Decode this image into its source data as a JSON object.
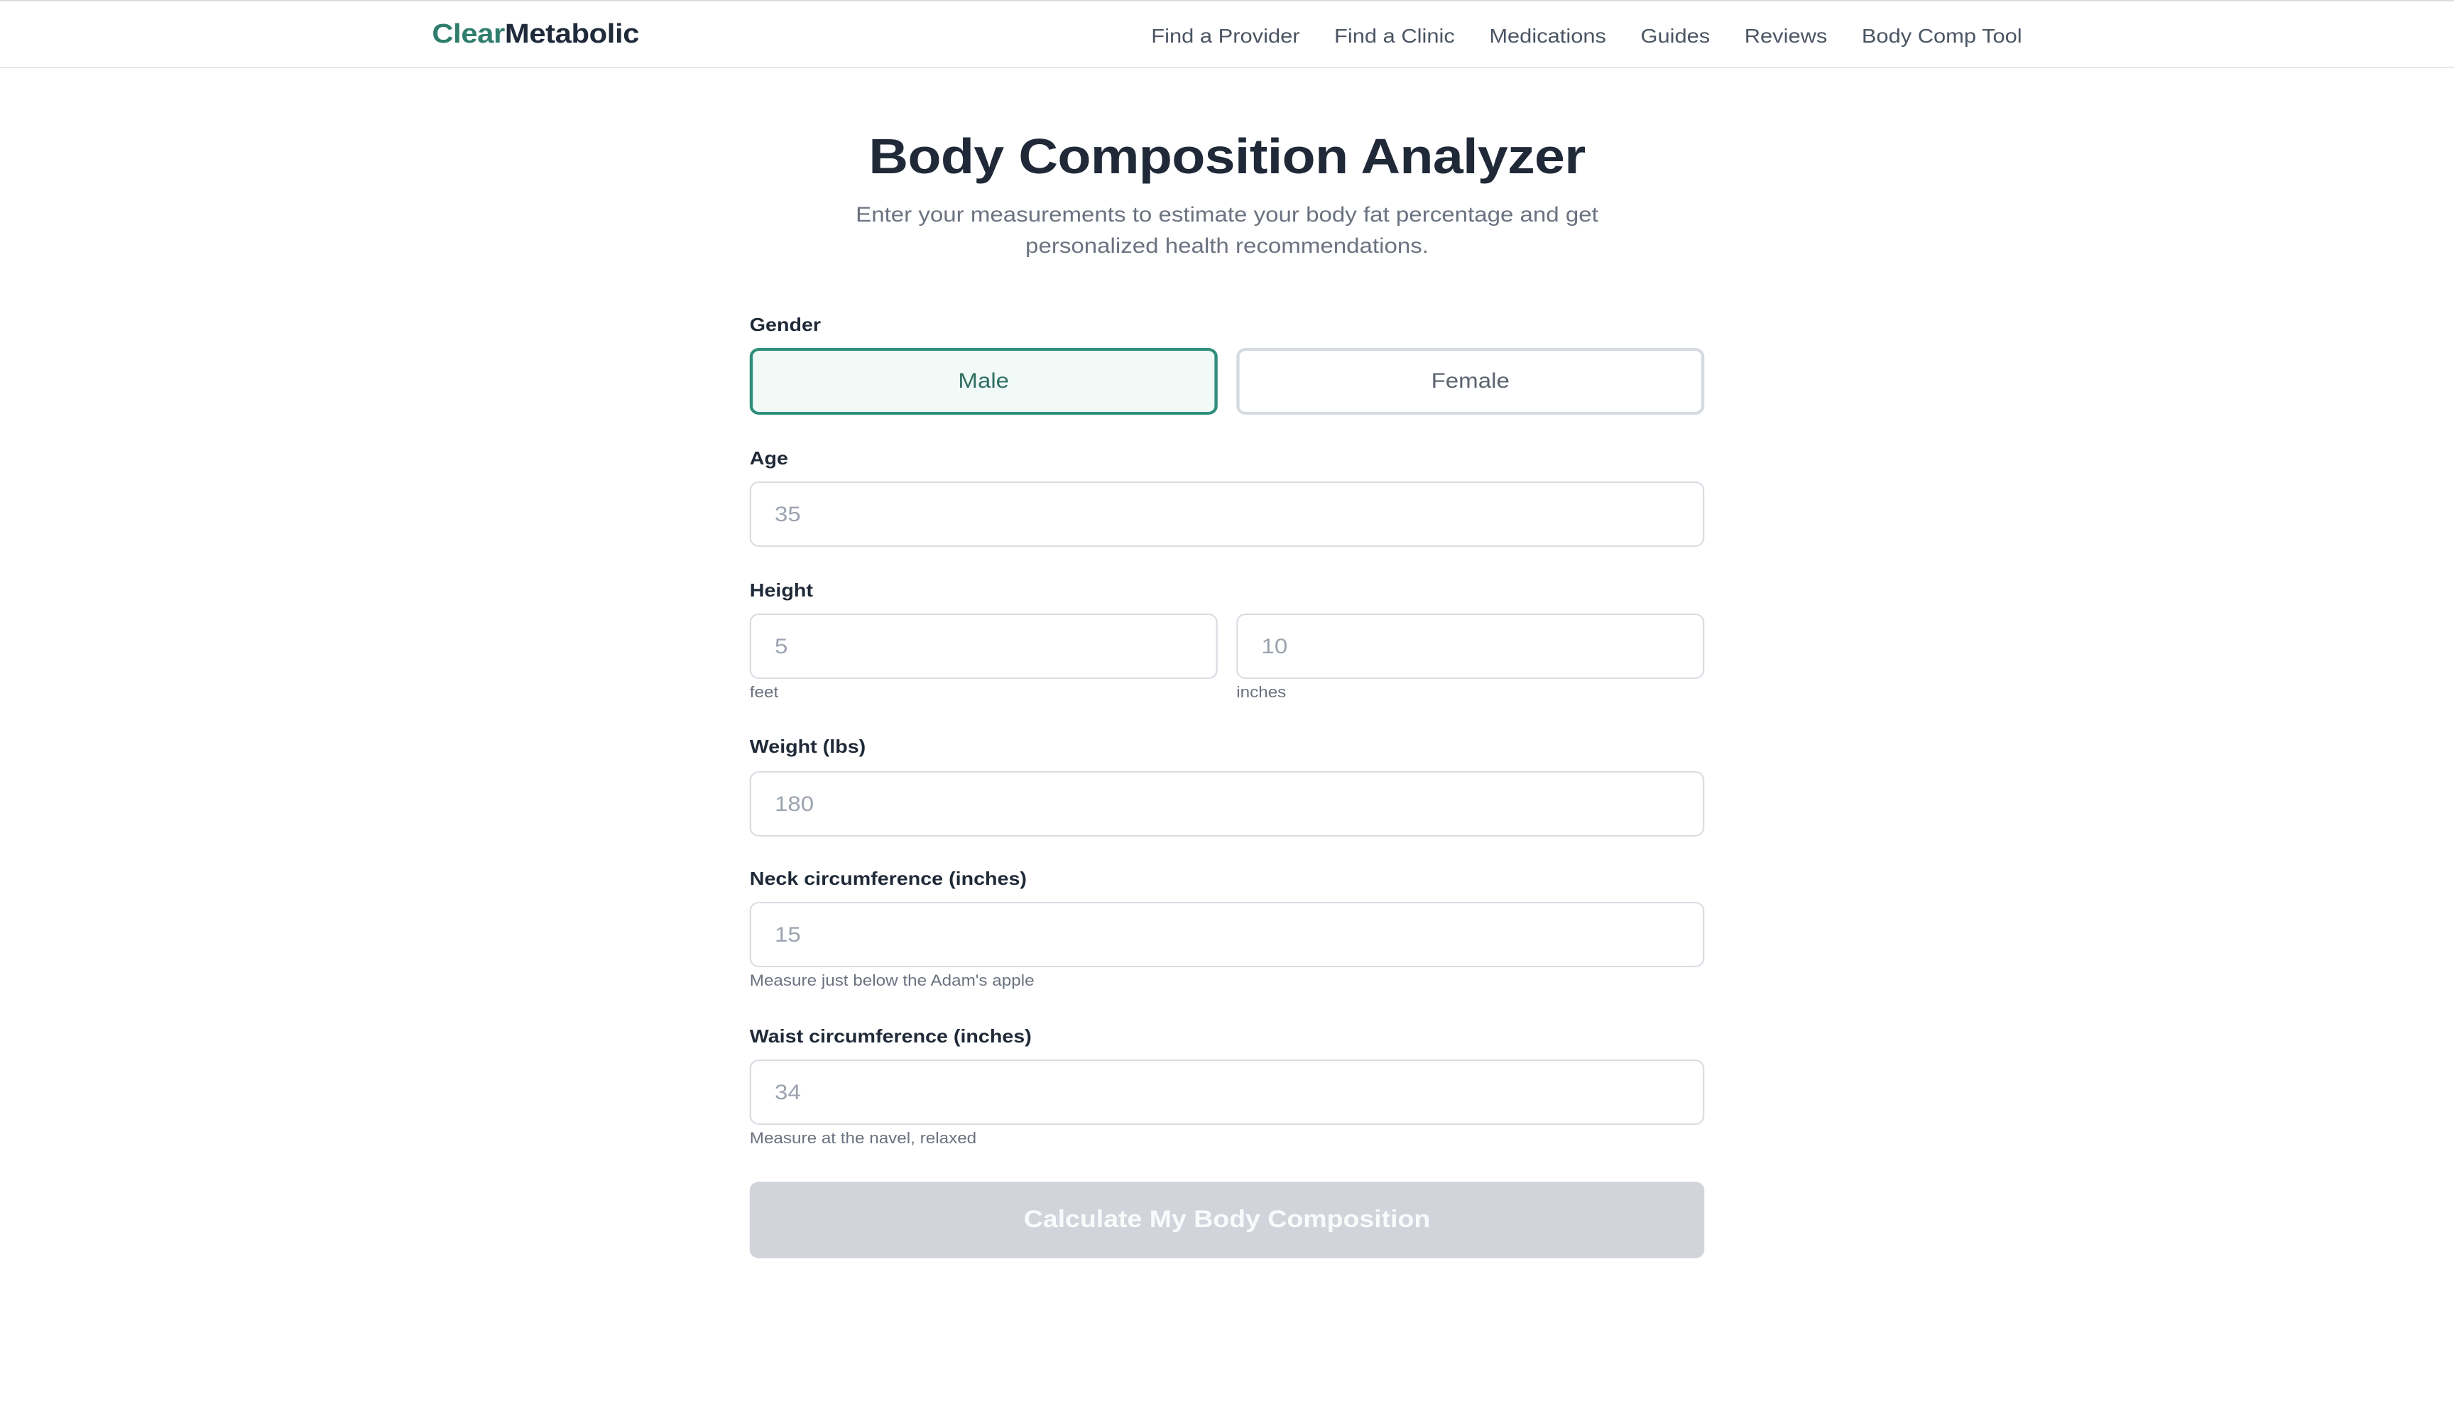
{
  "brand": {
    "name_part1": "Clear",
    "name_part2": "Metabolic"
  },
  "nav": {
    "items": [
      {
        "label": "Find a Provider"
      },
      {
        "label": "Find a Clinic"
      },
      {
        "label": "Medications"
      },
      {
        "label": "Guides"
      },
      {
        "label": "Reviews"
      },
      {
        "label": "Body Comp Tool"
      }
    ]
  },
  "header": {
    "title": "Body Composition Analyzer",
    "subtitle": "Enter your measurements to estimate your body fat percentage and get personalized health recommendations."
  },
  "form": {
    "gender": {
      "label": "Gender",
      "options": [
        "Male",
        "Female"
      ],
      "selected": "Male"
    },
    "age": {
      "label": "Age",
      "value": "",
      "placeholder": "35"
    },
    "height": {
      "label": "Height",
      "feet": {
        "value": "",
        "placeholder": "5",
        "unit": "feet"
      },
      "inches": {
        "value": "",
        "placeholder": "10",
        "unit": "inches"
      }
    },
    "weight": {
      "label": "Weight (lbs)",
      "value": "",
      "placeholder": "180"
    },
    "neck": {
      "label": "Neck circumference (inches)",
      "value": "",
      "placeholder": "15",
      "hint": "Measure just below the Adam's apple"
    },
    "waist": {
      "label": "Waist circumference (inches)",
      "value": "",
      "placeholder": "34",
      "hint": "Measure at the navel, relaxed"
    },
    "submit_label": "Calculate My Body Composition"
  },
  "colors": {
    "accent": "#2f8f7c",
    "brand_green": "#2f7d6d",
    "brand_dark": "#1f2a3a",
    "disabled_button": "#d1d5db"
  }
}
